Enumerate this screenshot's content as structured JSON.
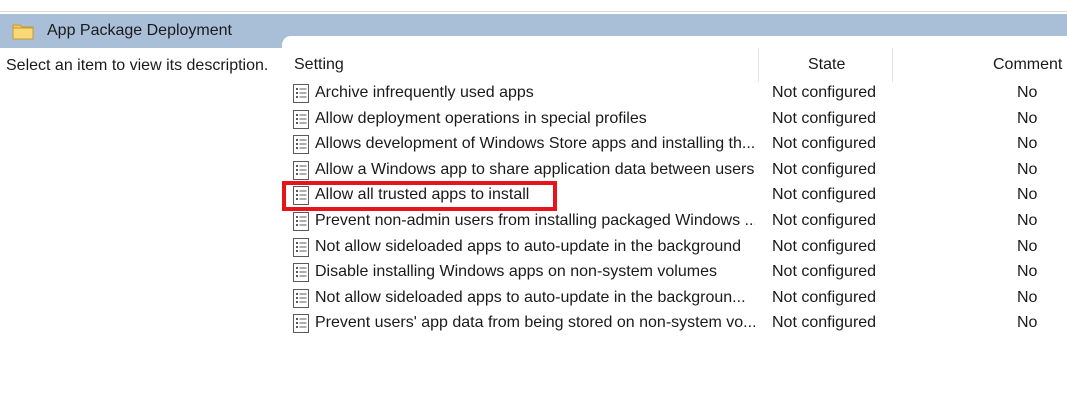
{
  "header": {
    "title": "App Package Deployment",
    "icon": "folder-icon"
  },
  "left_panel": {
    "description": "Select an item to view its description."
  },
  "columns": {
    "setting": "Setting",
    "state": "State",
    "comment": "Comment"
  },
  "rows": [
    {
      "setting": "Archive infrequently used apps",
      "state": "Not configured",
      "comment": "No"
    },
    {
      "setting": "Allow deployment operations in special profiles",
      "state": "Not configured",
      "comment": "No"
    },
    {
      "setting": "Allows development of Windows Store apps and installing th...",
      "state": "Not configured",
      "comment": "No"
    },
    {
      "setting": "Allow a Windows app to share application data between users",
      "state": "Not configured",
      "comment": "No"
    },
    {
      "setting": "Allow all trusted apps to install",
      "state": "Not configured",
      "comment": "No"
    },
    {
      "setting": "Prevent non-admin users from installing packaged Windows ...",
      "state": "Not configured",
      "comment": "No"
    },
    {
      "setting": "Not allow sideloaded apps to auto-update in the background",
      "state": "Not configured",
      "comment": "No"
    },
    {
      "setting": "Disable installing Windows apps on non-system volumes",
      "state": "Not configured",
      "comment": "No"
    },
    {
      "setting": "Not allow sideloaded apps to auto-update in the backgroun...",
      "state": "Not configured",
      "comment": "No"
    },
    {
      "setting": "Prevent users' app data from being stored on non-system vo...",
      "state": "Not configured",
      "comment": "No"
    }
  ],
  "highlight_color": "#e8141c",
  "header_color": "#a9bfd8"
}
